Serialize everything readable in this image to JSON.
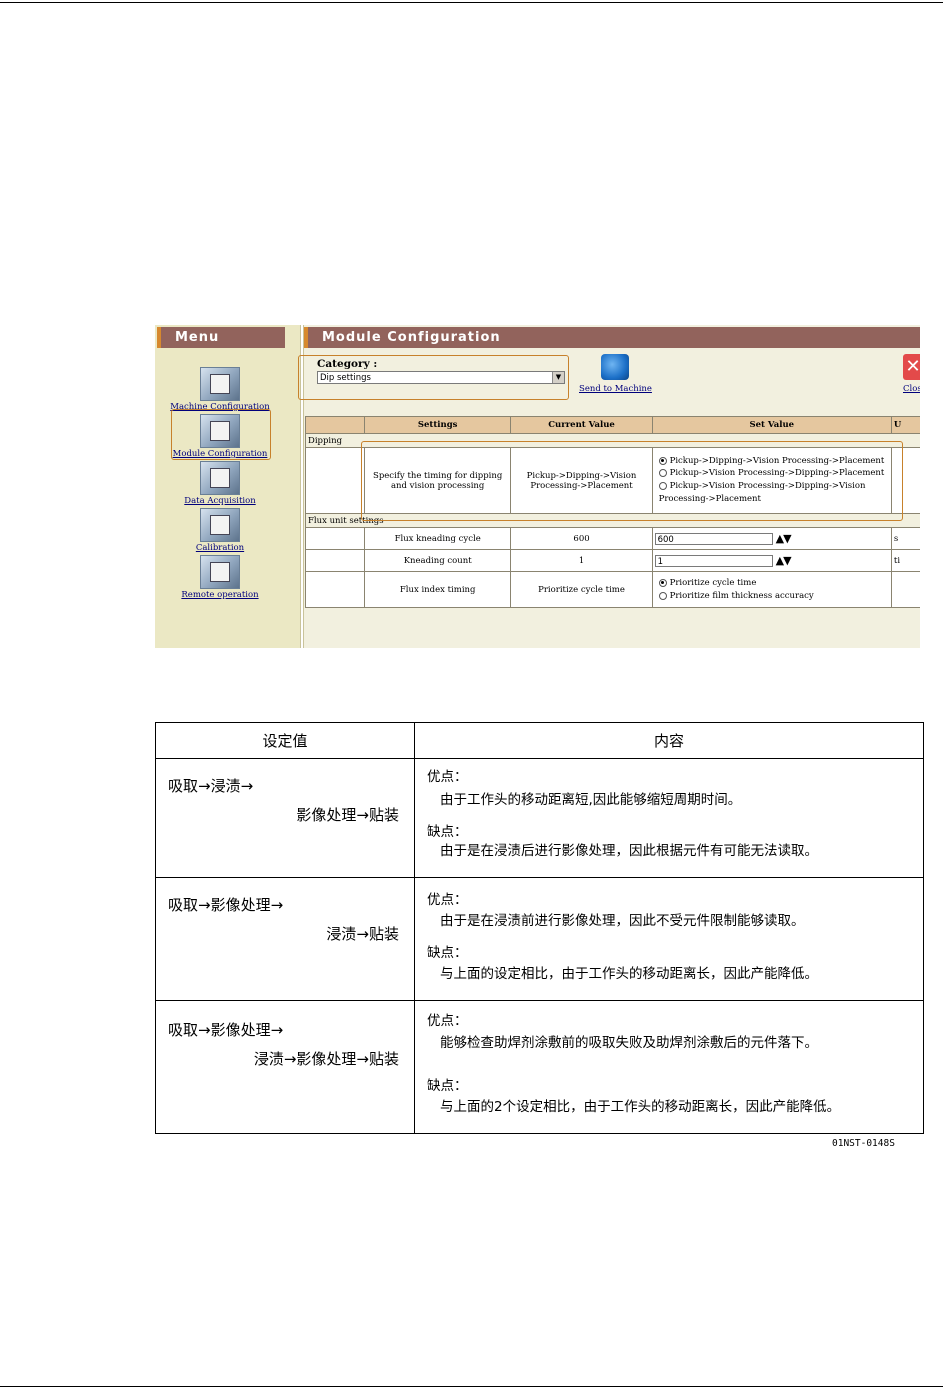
{
  "screenshot": {
    "menu": {
      "title": "Menu",
      "items": [
        {
          "label": "Machine Configuration",
          "icon": "machine-configuration-icon"
        },
        {
          "label": "Module Configuration",
          "icon": "module-configuration-icon"
        },
        {
          "label": "Data Acquisition",
          "icon": "data-acquisition-icon"
        },
        {
          "label": "Calibration",
          "icon": "calibration-icon"
        },
        {
          "label": "Remote operation",
          "icon": "remote-operation-icon"
        }
      ]
    },
    "main": {
      "title": "Module Configuration",
      "category_label": "Category :",
      "category_value": "Dip settings",
      "send_label": "Send to Machine",
      "close_label": "Close",
      "columns": [
        "Settings",
        "Current Value",
        "Set Value",
        "U"
      ],
      "groups": {
        "dipping": "Dipping",
        "flux": "Flux unit settings"
      },
      "dipping_row": {
        "setting": "Specify the timing for dipping and vision processing",
        "current": "Pickup->Dipping->Vision Processing->Placement",
        "options": [
          "Pickup->Dipping->Vision Processing->Placement",
          "Pickup->Vision Processing->Dipping->Placement",
          "Pickup->Vision Processing->Dipping->Vision Processing->Placement"
        ],
        "selected_index": 0
      },
      "flux_rows": [
        {
          "setting": "Flux kneading cycle",
          "current": "600",
          "value": "600",
          "unit": "s"
        },
        {
          "setting": "Kneading count",
          "current": "1",
          "value": "1",
          "unit": "ti"
        },
        {
          "setting": "Flux index timing",
          "current": "Prioritize cycle time",
          "options": [
            "Prioritize cycle time",
            "Prioritize film thickness accuracy"
          ],
          "selected_index": 0
        }
      ]
    },
    "colors": {
      "header_bar": "#92635c",
      "accent": "#d7892e",
      "menu_bg": "#ebe8c4",
      "table_header": "#e5c79f",
      "highlight": "#c7812b"
    }
  },
  "explanation": {
    "headers": [
      "设定值",
      "内容"
    ],
    "rows": [
      {
        "seq1": "吸取→浸渍→",
        "seq2": "影像处理→贴装",
        "pro_label": "优点：",
        "pro": "由于工作头的移动距离短,因此能够缩短周期时间。",
        "con_label": "缺点：",
        "con": "由于是在浸渍后进行影像处理，因此根据元件有可能无法读取。"
      },
      {
        "seq1": "吸取→影像处理→",
        "seq2": "浸渍→贴装",
        "pro_label": "优点：",
        "pro": "由于是在浸渍前进行影像处理，因此不受元件限制能够读取。",
        "con_label": "缺点：",
        "con": "与上面的设定相比，由于工作头的移动距离长，因此产能降低。"
      },
      {
        "seq1": "吸取→影像处理→",
        "seq2": "浸渍→影像处理→贴装",
        "pro_label": "优点：",
        "pro": "能够检查助焊剂涂敷前的吸取失败及助焊剂涂敷后的元件落下。",
        "con_label": "缺点：",
        "con": "与上面的2个设定相比，由于工作头的移动距离长，因此产能降低。"
      }
    ],
    "reference": "01NST-0148S"
  }
}
